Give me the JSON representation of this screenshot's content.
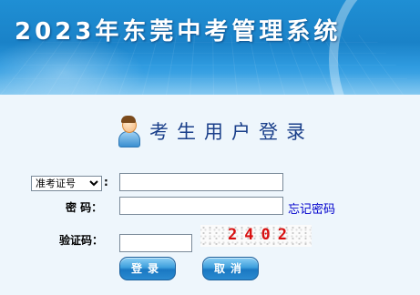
{
  "header": {
    "title": "2023年东莞中考管理系统"
  },
  "login": {
    "heading": "考生用户登录",
    "id_type": {
      "selected": "准考证号",
      "options": [
        "准考证号"
      ]
    },
    "id_colon": ":",
    "id_value": "",
    "password_label": "密  码：",
    "password_value": "",
    "forgot_link": "忘记密码",
    "captcha_label": "验证码：",
    "captcha_value": "",
    "captcha_code": "2402",
    "login_button": "登录",
    "cancel_button": "取消"
  },
  "colors": {
    "banner": "#1a82c8",
    "heading": "#1a3f8a",
    "link": "#0000cc",
    "captcha_text": "#d81010",
    "button": "#2a8ad0"
  }
}
